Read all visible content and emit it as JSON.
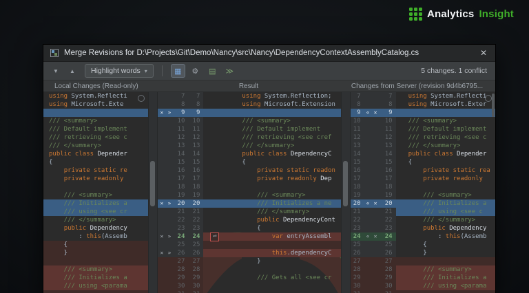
{
  "logo": {
    "primary": "Analytics",
    "secondary": "Insight"
  },
  "window": {
    "title": "Merge Revisions for D:\\Projects\\Git\\Demo\\Nancy\\src\\Nancy\\DependencyContextAssemblyCatalog.cs",
    "close_glyph": "✕"
  },
  "toolbar": {
    "nav_down": "▼",
    "nav_up": "▲",
    "highlight_mode": "Highlight words",
    "caret": "▾",
    "icon_viewer": "▦",
    "icon_gear": "⚙",
    "icon_columns": "▤",
    "icon_apply": "≫",
    "status": "5 changes. 1 conflict"
  },
  "headers": {
    "local": "Local Changes (Read-only)",
    "result": "Result",
    "server": "Changes from Server (revision 9d4b6795..."
  },
  "colors": {
    "accent": "#3fae29",
    "editor-bg": "#2b2b2b",
    "gutter-bg": "#313335",
    "hl-blue": "#3a5e84",
    "hl-red": "#5e3531",
    "hl-red-dim": "#3f2b28",
    "hl-green": "#2f4a39",
    "kw": "#cc7832",
    "doc": "#6a8759",
    "code": "#a9b7c6",
    "line-num": "#5f6468"
  },
  "merge": {
    "glyphs": {
      "ignore": "✕",
      "apply_ltr": "»",
      "apply_rtl": "«",
      "conflict_icon": "⇌"
    },
    "rows": [
      {
        "n": 7,
        "l": [
          [
            "using ",
            "k"
          ],
          [
            "System.Reflecti",
            "t"
          ]
        ],
        "m": [
          [
            "using ",
            "k"
          ],
          [
            "System.Reflection;",
            "t"
          ]
        ],
        "r": [
          [
            "using ",
            "k"
          ],
          [
            "System.Reflecti",
            "t"
          ]
        ]
      },
      {
        "n": 8,
        "l": [
          [
            "using ",
            "k"
          ],
          [
            "Microsoft.Exte",
            "t"
          ]
        ],
        "m": [
          [
            "using ",
            "k"
          ],
          [
            "Microsoft.Extension",
            "t"
          ]
        ],
        "r": [
          [
            "using ",
            "k"
          ],
          [
            "Microsoft.Exter",
            "t"
          ]
        ]
      },
      {
        "n": 9,
        "l": [],
        "m": [],
        "r": [],
        "hl": "b",
        "hm": "b",
        "hr": "b",
        "gl": "b",
        "gr": "b",
        "lm": true,
        "rm": true
      },
      {
        "n": 10,
        "l": [
          [
            "/// <summary>",
            "d"
          ]
        ],
        "m": [
          [
            "/// <summary>",
            "d"
          ]
        ],
        "r": [
          [
            "/// <summary>",
            "d"
          ]
        ]
      },
      {
        "n": 11,
        "l": [
          [
            "/// Default implement",
            "d"
          ]
        ],
        "m": [
          [
            "/// Default implement",
            "d"
          ]
        ],
        "r": [
          [
            "/// Default implement",
            "d"
          ]
        ]
      },
      {
        "n": 12,
        "l": [
          [
            "/// retrieving <see c",
            "d"
          ]
        ],
        "m": [
          [
            "/// retrieving <see cref",
            "d"
          ]
        ],
        "r": [
          [
            "/// retrieving <see c",
            "d"
          ]
        ]
      },
      {
        "n": 13,
        "l": [
          [
            "/// </summary>",
            "d"
          ]
        ],
        "m": [
          [
            "/// </summary>",
            "d"
          ]
        ],
        "r": [
          [
            "/// </summary>",
            "d"
          ]
        ]
      },
      {
        "n": 14,
        "l": [
          [
            "public class ",
            "k"
          ],
          [
            "Depender",
            "y"
          ]
        ],
        "m": [
          [
            "public class ",
            "k"
          ],
          [
            "DependencyC",
            "y"
          ]
        ],
        "r": [
          [
            "public class ",
            "k"
          ],
          [
            "Depender",
            "y"
          ]
        ]
      },
      {
        "n": 15,
        "l": [
          [
            "{",
            "t"
          ]
        ],
        "m": [
          [
            "{",
            "t"
          ]
        ],
        "r": [
          [
            "{",
            "t"
          ]
        ]
      },
      {
        "n": 16,
        "l": [
          [
            "    ",
            "t"
          ],
          [
            "private static re",
            "k"
          ]
        ],
        "m": [
          [
            "    ",
            "t"
          ],
          [
            "private static readon",
            "k"
          ]
        ],
        "r": [
          [
            "    ",
            "t"
          ],
          [
            "private static rea",
            "k"
          ]
        ]
      },
      {
        "n": 17,
        "l": [
          [
            "    ",
            "t"
          ],
          [
            "private readonly",
            "k"
          ]
        ],
        "m": [
          [
            "    ",
            "t"
          ],
          [
            "private readonly ",
            "k"
          ],
          [
            "Dep",
            "y"
          ]
        ],
        "r": [
          [
            "    ",
            "t"
          ],
          [
            "private readonly",
            "k"
          ]
        ]
      },
      {
        "n": 18,
        "l": [],
        "m": [],
        "r": []
      },
      {
        "n": 19,
        "l": [
          [
            "    /// <summary>",
            "d"
          ]
        ],
        "m": [
          [
            "    /// <summary>",
            "d"
          ]
        ],
        "r": [
          [
            "    /// <summary>",
            "d"
          ]
        ]
      },
      {
        "n": 20,
        "l": [
          [
            "    /// Initializes a",
            "d"
          ]
        ],
        "m": [
          [
            "    /// Initializes a ne",
            "d"
          ]
        ],
        "r": [
          [
            "    /// Initializes a",
            "d"
          ]
        ],
        "hl": "b",
        "hm": "b",
        "hr": "b",
        "gl": "b",
        "gr": "b",
        "lm": true,
        "rm": true
      },
      {
        "n": 21,
        "l": [
          [
            "    /// using <see cr",
            "d"
          ]
        ],
        "m": [
          [
            "    /// </summary>",
            "d"
          ]
        ],
        "r": [
          [
            "    /// using <see c",
            "d"
          ]
        ],
        "hl": "b",
        "hr": "b"
      },
      {
        "n": 22,
        "l": [
          [
            "    /// </summary>",
            "d"
          ]
        ],
        "m": [
          [
            "    ",
            "t"
          ],
          [
            "public ",
            "k"
          ],
          [
            "DependencyCont",
            "y"
          ]
        ],
        "r": [
          [
            "    /// </summary>",
            "d"
          ]
        ]
      },
      {
        "n": 23,
        "l": [
          [
            "    ",
            "t"
          ],
          [
            "public ",
            "k"
          ],
          [
            "Dependency",
            "y"
          ]
        ],
        "m": [
          [
            "    {",
            "t"
          ]
        ],
        "r": [
          [
            "    ",
            "t"
          ],
          [
            "public ",
            "k"
          ],
          [
            "Dependency",
            "y"
          ]
        ]
      },
      {
        "n": 24,
        "l": [
          [
            "        : ",
            "t"
          ],
          [
            "this",
            "k"
          ],
          [
            "(Assemb",
            "t"
          ]
        ],
        "m": [
          [
            "        ",
            "t"
          ],
          [
            "var",
            "k"
          ],
          [
            " entryAssembl",
            "t"
          ]
        ],
        "r": [
          [
            "        : ",
            "t"
          ],
          [
            "this",
            "k"
          ],
          [
            "(Assemb",
            "t"
          ]
        ],
        "hm": "r",
        "lm": true,
        "rm": true,
        "icon": true,
        "ng": true,
        "gr": "g"
      },
      {
        "n": 25,
        "l": [
          [
            "    {",
            "t"
          ]
        ],
        "m": [],
        "r": [
          [
            "    {",
            "t"
          ]
        ],
        "hl": "rd",
        "hm": "rd"
      },
      {
        "n": 26,
        "l": [
          [
            "    }",
            "t"
          ]
        ],
        "m": [
          [
            "        ",
            "t"
          ],
          [
            "this",
            "k"
          ],
          [
            ".dependencyC",
            "t"
          ]
        ],
        "r": [
          [
            "    }",
            "t"
          ]
        ],
        "hl": "rd",
        "hm": "r",
        "lm": true
      },
      {
        "n": 27,
        "l": [],
        "m": [
          [
            "    }",
            "t"
          ]
        ],
        "r": [],
        "hl": "rd",
        "hr": "rd",
        "gl": "rd",
        "gr": "rd"
      },
      {
        "n": 28,
        "l": [
          [
            "    /// <summary>",
            "d"
          ]
        ],
        "m": [],
        "r": [
          [
            "    /// <summary>",
            "d"
          ]
        ],
        "hl": "r",
        "hr": "r",
        "gl": "rd",
        "gr": "rd"
      },
      {
        "n": 29,
        "l": [
          [
            "    /// Initializes a",
            "d"
          ]
        ],
        "m": [
          [
            "    /// Gets all <see cr",
            "d"
          ]
        ],
        "r": [
          [
            "    /// Initializes a",
            "d"
          ]
        ],
        "hl": "r",
        "hr": "r",
        "gl": "rd",
        "gr": "rd"
      },
      {
        "n": 30,
        "l": [
          [
            "    /// using <parama",
            "d"
          ]
        ],
        "m": [],
        "r": [
          [
            "    /// using <parama",
            "d"
          ]
        ],
        "hl": "r",
        "hr": "r",
        "gl": "rd",
        "gr": "rd"
      },
      {
        "n": 31,
        "l": [],
        "m": [],
        "r": [],
        "hl": "rd",
        "hr": "rd",
        "gl": "rd",
        "gr": "rd"
      }
    ]
  }
}
